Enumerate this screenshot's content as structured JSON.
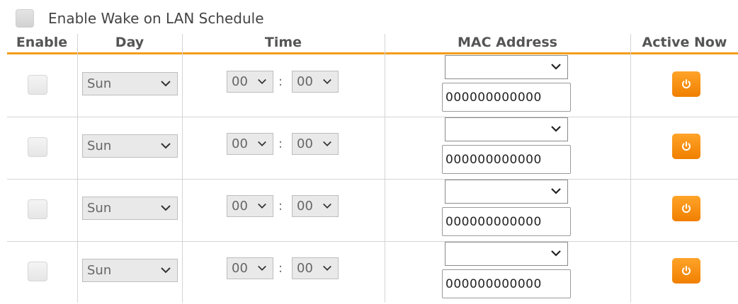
{
  "master": {
    "label": "Enable Wake on LAN Schedule",
    "checked": false
  },
  "columns": {
    "enable": "Enable",
    "day": "Day",
    "time": "Time",
    "mac": "MAC Address",
    "active": "Active Now"
  },
  "time_separator": ":",
  "rows": [
    {
      "enabled": false,
      "day": "Sun",
      "hour": "00",
      "minute": "00",
      "mac_select": "",
      "mac_value": "000000000000"
    },
    {
      "enabled": false,
      "day": "Sun",
      "hour": "00",
      "minute": "00",
      "mac_select": "",
      "mac_value": "000000000000"
    },
    {
      "enabled": false,
      "day": "Sun",
      "hour": "00",
      "minute": "00",
      "mac_select": "",
      "mac_value": "000000000000"
    },
    {
      "enabled": false,
      "day": "Sun",
      "hour": "00",
      "minute": "00",
      "mac_select": "",
      "mac_value": "000000000000"
    }
  ],
  "icons": {
    "dropdown": "chevron-down-icon",
    "active": "power-icon"
  },
  "colors": {
    "accent": "#f39c1a",
    "button": "#f28a0c"
  }
}
